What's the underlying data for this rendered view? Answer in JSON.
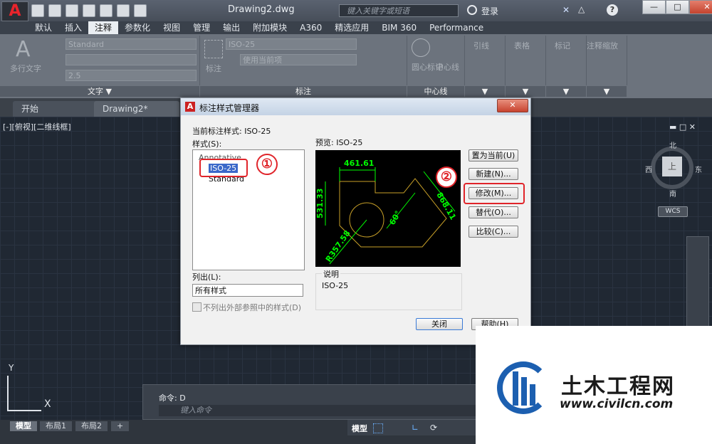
{
  "titlebar": {
    "app_logo": "A",
    "doc_title": "Drawing2.dwg",
    "search_placeholder": "键入关键字或短语",
    "login": "登录"
  },
  "menubar": {
    "items": [
      "默认",
      "插入",
      "注释",
      "参数化",
      "视图",
      "管理",
      "输出",
      "附加模块",
      "A360",
      "精选应用",
      "BIM 360",
      "Performance"
    ],
    "active": "注释"
  },
  "ribbon": {
    "text_panel": {
      "big_button": "多行文字",
      "style_value": "Standard",
      "height_value": "2.5",
      "label": "文字 ▼"
    },
    "dim_panel": {
      "label": "标注",
      "style_value": "ISO-25",
      "layer_value": "使用当前项"
    },
    "center_panel": {
      "btn1": "圆心标记",
      "btn2": "中心线",
      "label": "中心线"
    },
    "more_panels": [
      "引线",
      "表格",
      "标记",
      "注释缩放"
    ]
  },
  "tabs": {
    "start": "开始",
    "drawing": "Drawing2*"
  },
  "viewport_label": "[-][俯视][二维线框]",
  "viewcube": {
    "north": "北",
    "south": "南",
    "east": "东",
    "west": "西",
    "top": "上",
    "wcs": "WCS"
  },
  "command": {
    "history": "命令: D",
    "placeholder": "键入命令"
  },
  "layout_tabs": [
    "模型",
    "布局1",
    "布局2",
    "+"
  ],
  "status": {
    "model": "模型"
  },
  "ucs": {
    "y": "Y",
    "x": "X"
  },
  "dialog": {
    "title": "标注样式管理器",
    "current_style_label": "当前标注样式: ISO-25",
    "styles_label": "样式(S):",
    "styles": [
      "Annotative",
      "ISO-25",
      "Standard"
    ],
    "selected_style": "ISO-25",
    "preview_label": "预览: ISO-25",
    "list_label": "列出(L):",
    "list_value": "所有样式",
    "xref_checkbox": "不列出外部参照中的样式(D)",
    "desc_label": "说明",
    "desc_value": "ISO-25",
    "buttons": {
      "set_current": "置为当前(U)",
      "new": "新建(N)...",
      "modify": "修改(M)...",
      "override": "替代(O)...",
      "compare": "比较(C)...",
      "close": "关闭",
      "help": "帮助(H)"
    },
    "preview_dims": {
      "top": "461.61",
      "left": "531.33",
      "diag": "868.11",
      "angle": "60°",
      "radius": "R357.58"
    }
  },
  "annotations": {
    "one": "①",
    "two": "②"
  },
  "watermark": {
    "title": "土木工程网",
    "url": "www.civilcn.com"
  }
}
